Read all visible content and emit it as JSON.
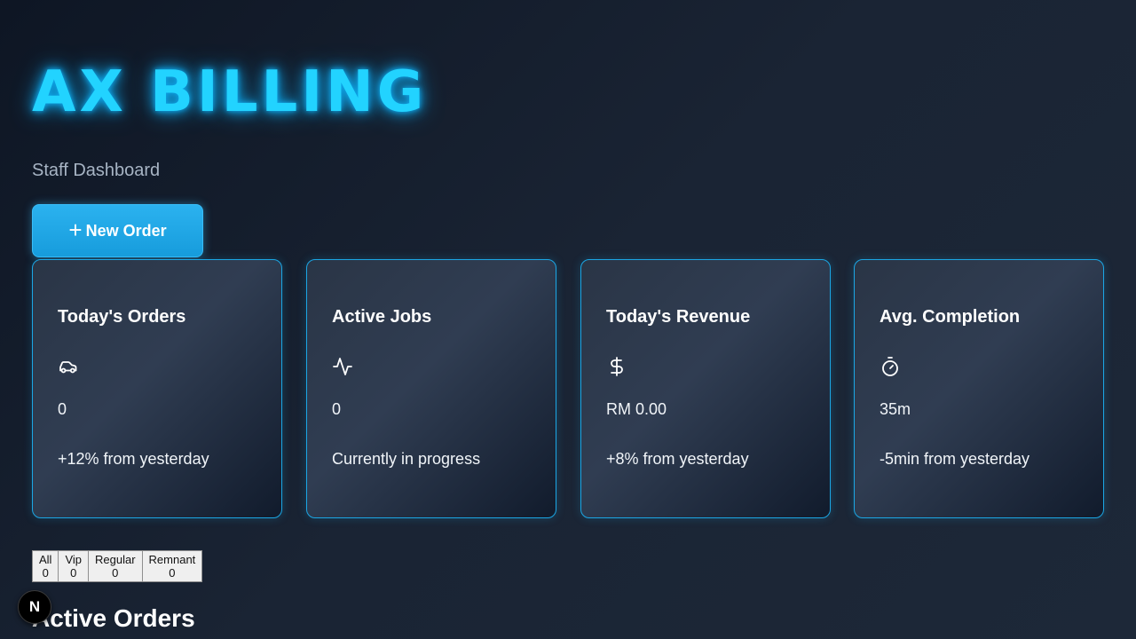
{
  "header": {
    "brand": "AX BILLING",
    "subtitle": "Staff Dashboard"
  },
  "actions": {
    "new_order_label": "New Order",
    "new_order_icon": "plus-icon"
  },
  "stats": [
    {
      "title": "Today's Orders",
      "icon": "car-icon",
      "value": "0",
      "note": "+12% from yesterday"
    },
    {
      "title": "Active Jobs",
      "icon": "activity-icon",
      "value": "0",
      "note": "Currently in progress"
    },
    {
      "title": "Today's Revenue",
      "icon": "dollar-icon",
      "value": "RM 0.00",
      "note": "+8% from yesterday"
    },
    {
      "title": "Avg. Completion",
      "icon": "stopwatch-icon",
      "value": "35m",
      "note": "-5min from yesterday"
    }
  ],
  "filters": [
    {
      "label": "All",
      "count": "0"
    },
    {
      "label": "Vip",
      "count": "0"
    },
    {
      "label": "Regular",
      "count": "0"
    },
    {
      "label": "Remnant",
      "count": "0"
    }
  ],
  "orders": {
    "title": "Active Orders"
  },
  "dev_badge": {
    "label": "N"
  },
  "colors": {
    "accent": "#22d3ff",
    "button": "#1fa8e8",
    "card_border": "#1ba6e4",
    "background": "#161f2e"
  }
}
